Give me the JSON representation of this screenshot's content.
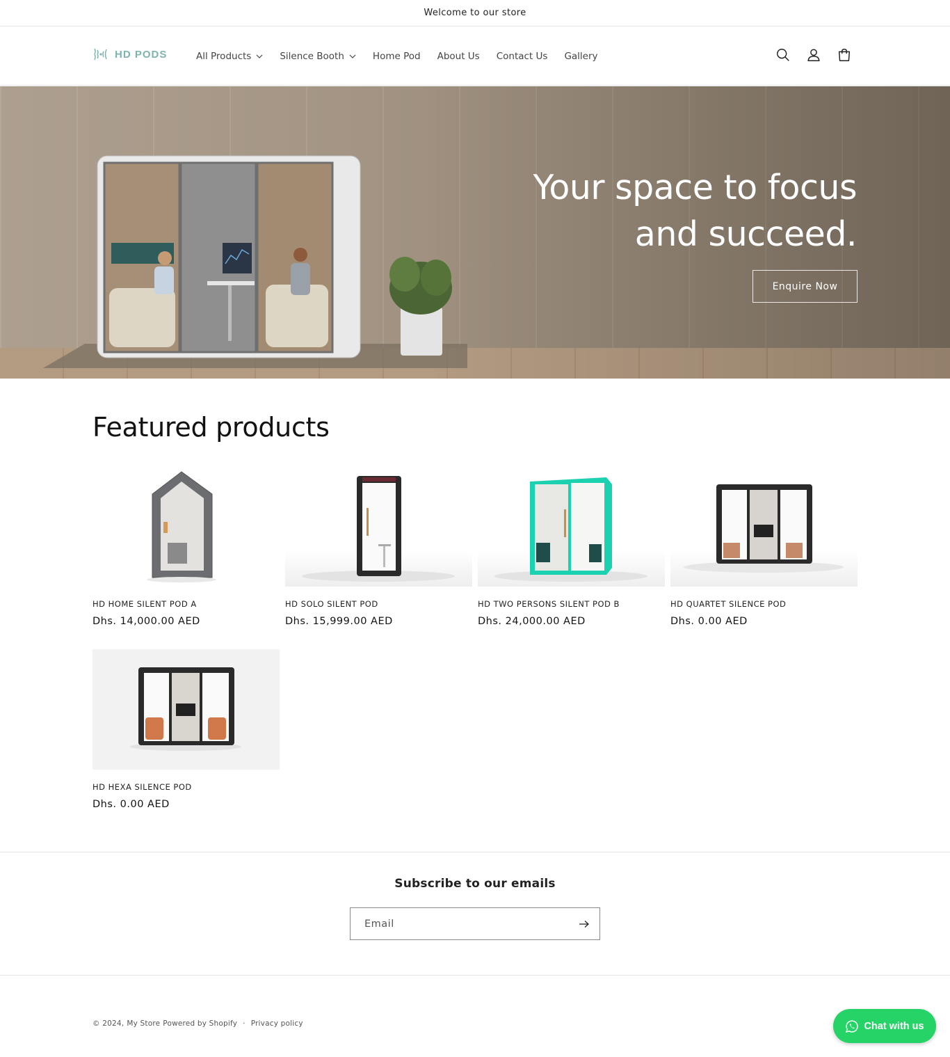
{
  "announcement": "Welcome to our store",
  "brand": {
    "name": "HD PODS",
    "color": "#7fb4ae"
  },
  "nav": {
    "items": [
      {
        "label": "All Products",
        "dropdown": true
      },
      {
        "label": "Silence Booth",
        "dropdown": true
      },
      {
        "label": "Home Pod",
        "dropdown": false
      },
      {
        "label": "About Us",
        "dropdown": false
      },
      {
        "label": "Contact Us",
        "dropdown": false
      },
      {
        "label": "Gallery",
        "dropdown": false
      }
    ]
  },
  "header_icons": [
    "search-icon",
    "account-icon",
    "cart-icon"
  ],
  "hero": {
    "title": "Your space to focus and succeed.",
    "button": "Enquire Now"
  },
  "featured": {
    "title": "Featured products",
    "products": [
      {
        "name": "HD HOME SILENT POD A",
        "price": "Dhs. 14,000.00 AED"
      },
      {
        "name": "HD SOLO SILENT POD",
        "price": "Dhs. 15,999.00 AED"
      },
      {
        "name": "HD TWO PERSONS SILENT POD B",
        "price": "Dhs. 24,000.00 AED"
      },
      {
        "name": "HD QUARTET SILENCE POD",
        "price": "Dhs. 0.00 AED"
      },
      {
        "name": "HD HEXA SILENCE POD",
        "price": "Dhs. 0.00 AED"
      }
    ]
  },
  "subscribe": {
    "title": "Subscribe to our emails",
    "placeholder": "Email"
  },
  "footer": {
    "copyright": "© 2024,",
    "store": "My Store",
    "powered": "Powered by Shopify",
    "separator": "·",
    "privacy": "Privacy policy"
  },
  "chat": {
    "label": "Chat with us",
    "color": "#25d366"
  }
}
